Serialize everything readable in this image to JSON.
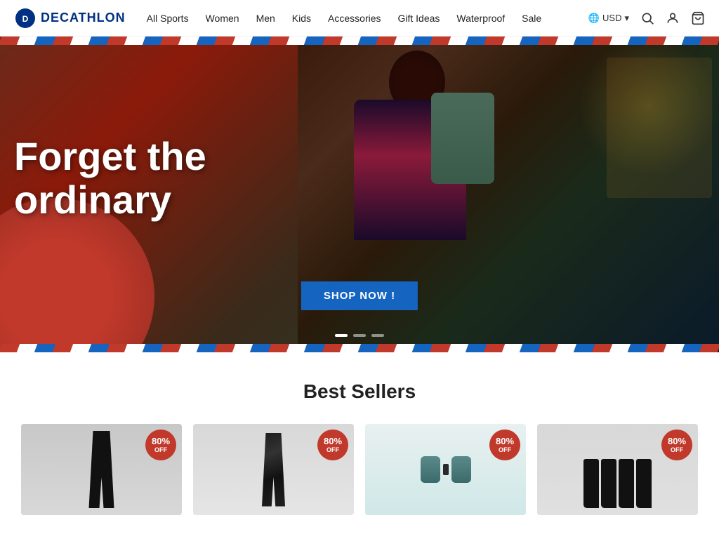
{
  "navbar": {
    "logo_text": "DECATHLON",
    "nav_links": [
      {
        "id": "all-sports",
        "label": "All Sports"
      },
      {
        "id": "women",
        "label": "Women"
      },
      {
        "id": "men",
        "label": "Men"
      },
      {
        "id": "kids",
        "label": "Kids"
      },
      {
        "id": "accessories",
        "label": "Accessories"
      },
      {
        "id": "gift-ideas",
        "label": "Gift Ideas"
      },
      {
        "id": "waterproof",
        "label": "Waterproof"
      },
      {
        "id": "sale",
        "label": "Sale"
      }
    ],
    "currency": "USD",
    "currency_icon": "🌐"
  },
  "hero": {
    "headline_line1": "orget the",
    "headline_line2": "ordinary",
    "cta_button": "SHOP NOW !",
    "dots": [
      {
        "active": true
      },
      {
        "active": false
      },
      {
        "active": false
      }
    ]
  },
  "best_sellers": {
    "title": "Best Sellers",
    "products": [
      {
        "id": "product-1",
        "type": "leggings-black",
        "badge_pct": "80%",
        "badge_label": "OFF"
      },
      {
        "id": "product-2",
        "type": "leggings-marble",
        "badge_pct": "80%",
        "badge_label": "OFF"
      },
      {
        "id": "product-3",
        "type": "binoculars",
        "badge_pct": "80%",
        "badge_label": "OFF"
      },
      {
        "id": "product-4",
        "type": "socks",
        "badge_pct": "80%",
        "badge_label": "OFF"
      }
    ]
  },
  "stripes": {
    "colors": [
      "#c0392b",
      "#fff",
      "#1565c0",
      "#c0392b",
      "#fff",
      "#1565c0",
      "#c0392b",
      "#fff",
      "#1565c0",
      "#c0392b",
      "#fff",
      "#1565c0",
      "#c0392b",
      "#fff",
      "#1565c0",
      "#c0392b",
      "#fff",
      "#1565c0",
      "#c0392b",
      "#fff",
      "#1565c0",
      "#c0392b",
      "#fff",
      "#1565c0",
      "#c0392b",
      "#fff",
      "#1565c0",
      "#c0392b",
      "#fff",
      "#1565c0",
      "#c0392b",
      "#fff",
      "#1565c0",
      "#c0392b",
      "#fff",
      "#1565c0",
      "#c0392b",
      "#fff",
      "#1565c0",
      "#c0392b"
    ]
  }
}
